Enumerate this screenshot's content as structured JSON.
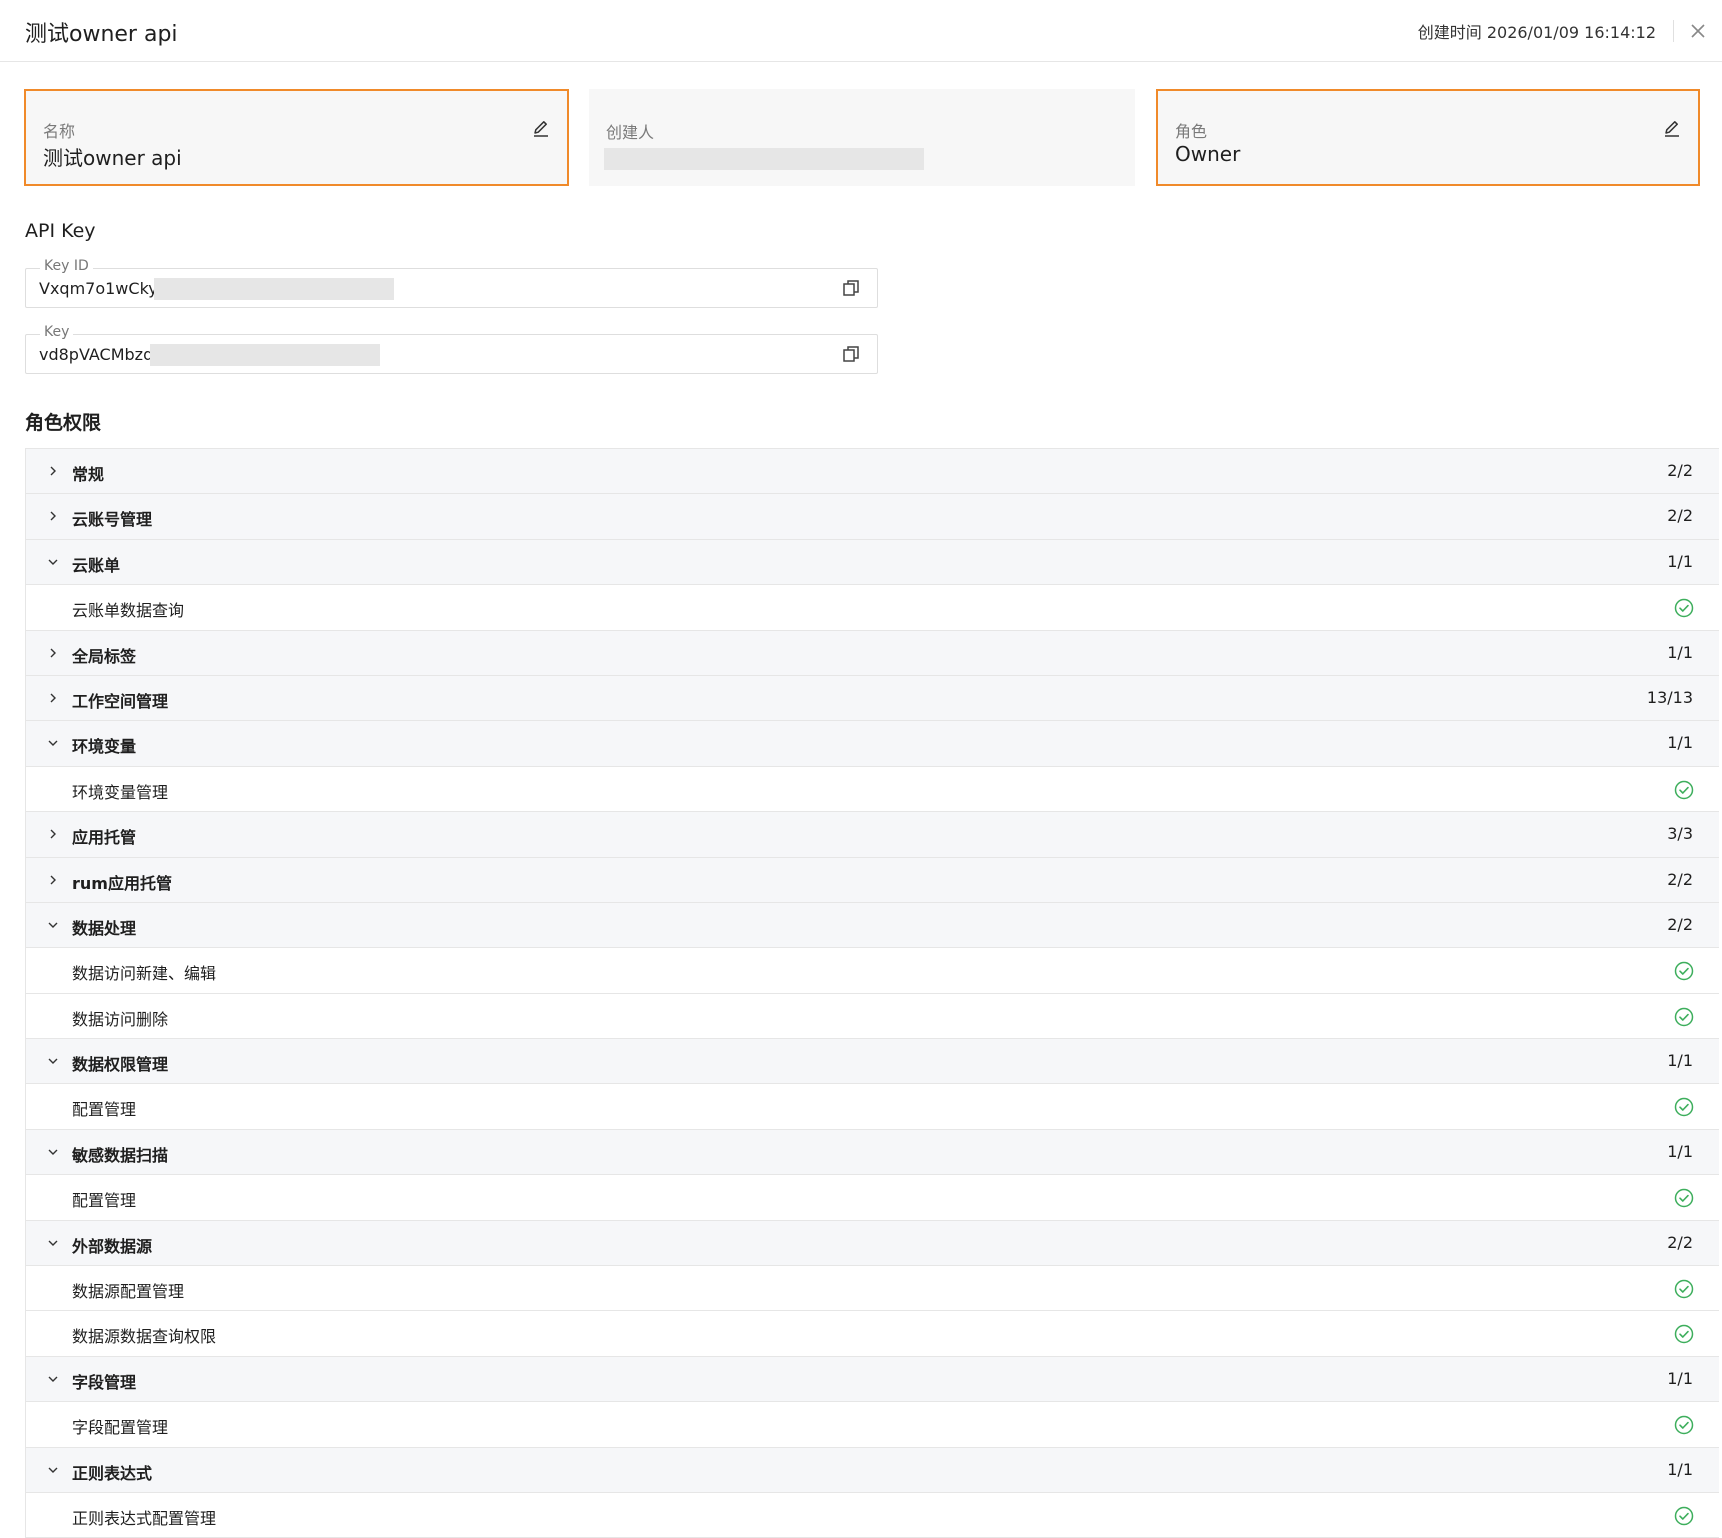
{
  "header": {
    "title": "测试owner api",
    "created_label": "创建时间",
    "created_time": "2026/01/09 16:14:12"
  },
  "cards": {
    "name": {
      "label": "名称",
      "value": "测试owner api"
    },
    "creator": {
      "label": "创建人"
    },
    "role": {
      "label": "角色",
      "value": "Owner"
    }
  },
  "api_key": {
    "section_title": "API Key",
    "key_id_label": "Key ID",
    "key_id_value": "Vxqm7o1wCky",
    "key_label": "Key",
    "key_value": "vd8pVACMbzq"
  },
  "permissions": {
    "section_title": "角色权限",
    "rows": [
      {
        "type": "group",
        "label": "常规",
        "expanded": false,
        "count": "2/2"
      },
      {
        "type": "group",
        "label": "云账号管理",
        "expanded": false,
        "count": "2/2"
      },
      {
        "type": "group",
        "label": "云账单",
        "expanded": true,
        "count": "1/1"
      },
      {
        "type": "item",
        "label": "云账单数据查询",
        "granted": true
      },
      {
        "type": "group",
        "label": "全局标签",
        "expanded": false,
        "count": "1/1"
      },
      {
        "type": "group",
        "label": "工作空间管理",
        "expanded": false,
        "count": "13/13"
      },
      {
        "type": "group",
        "label": "环境变量",
        "expanded": true,
        "count": "1/1"
      },
      {
        "type": "item",
        "label": "环境变量管理",
        "granted": true
      },
      {
        "type": "group",
        "label": "应用托管",
        "expanded": false,
        "count": "3/3"
      },
      {
        "type": "group",
        "label": "rum应用托管",
        "expanded": false,
        "count": "2/2"
      },
      {
        "type": "group",
        "label": "数据处理",
        "expanded": true,
        "count": "2/2"
      },
      {
        "type": "item",
        "label": "数据访问新建、编辑",
        "granted": true
      },
      {
        "type": "item",
        "label": "数据访问删除",
        "granted": true
      },
      {
        "type": "group",
        "label": "数据权限管理",
        "expanded": true,
        "count": "1/1"
      },
      {
        "type": "item",
        "label": "配置管理",
        "granted": true
      },
      {
        "type": "group",
        "label": "敏感数据扫描",
        "expanded": true,
        "count": "1/1"
      },
      {
        "type": "item",
        "label": "配置管理",
        "granted": true
      },
      {
        "type": "group",
        "label": "外部数据源",
        "expanded": true,
        "count": "2/2"
      },
      {
        "type": "item",
        "label": "数据源配置管理",
        "granted": true
      },
      {
        "type": "item",
        "label": "数据源数据查询权限",
        "granted": true
      },
      {
        "type": "group",
        "label": "字段管理",
        "expanded": true,
        "count": "1/1"
      },
      {
        "type": "item",
        "label": "字段配置管理",
        "granted": true
      },
      {
        "type": "group",
        "label": "正则表达式",
        "expanded": true,
        "count": "1/1"
      },
      {
        "type": "item",
        "label": "正则表达式配置管理",
        "granted": true
      }
    ]
  },
  "colors": {
    "accent_border": "#f08a2a",
    "check_green": "#3dae5c",
    "group_bg": "#f6f7f9"
  }
}
